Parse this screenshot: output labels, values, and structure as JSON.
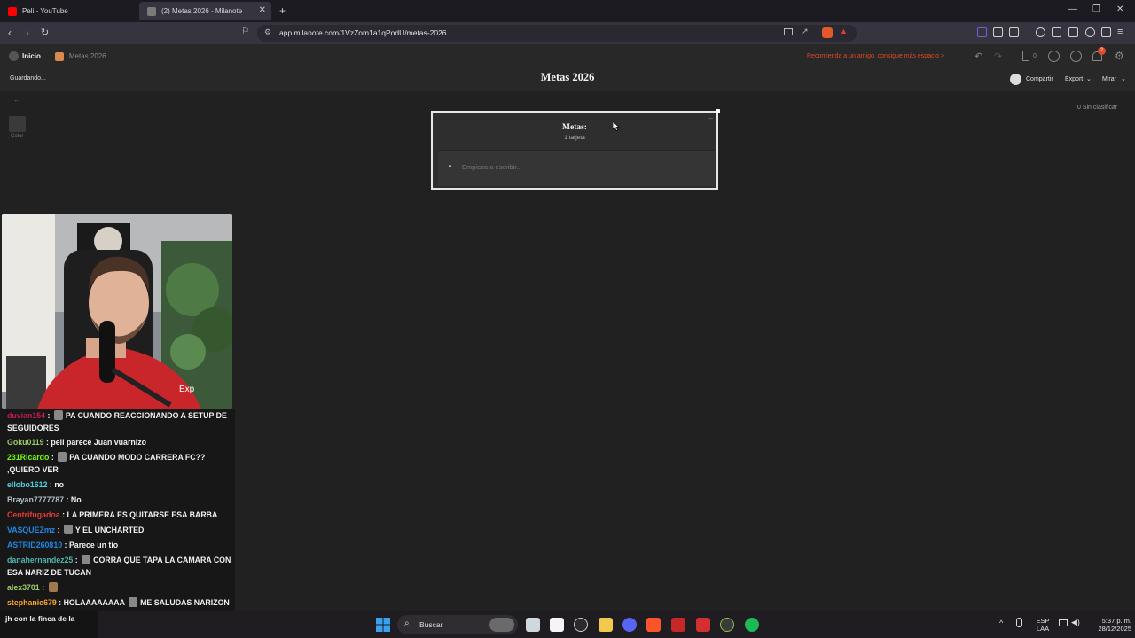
{
  "browser": {
    "tabs": [
      {
        "title": "Peli - YouTube",
        "active": false,
        "favicon_color": "#ff0000"
      },
      {
        "title": "(2) Metas 2026 - Milanote",
        "active": true,
        "favicon_color": "#7a7a7a"
      }
    ],
    "new_tab_label": "+",
    "url": "app.milanote.com/1VzZom1a1qPodU/metas-2026"
  },
  "app": {
    "breadcrumb": {
      "home": "Inicio",
      "board": "Metas 2026"
    },
    "save_status": "Guardando...",
    "board_title": "Metas 2026",
    "promo": "Recomienda a un amigo, consigue más espacio >",
    "card_counter": "0",
    "notifications_count": "2",
    "share_label": "Compartir",
    "export_label": "Export",
    "view_label": "Mirar",
    "unsorted_label": "0 Sin clasificar",
    "toolbar": {
      "color_label": "Color"
    },
    "column": {
      "title": "Metas:",
      "count": "1 tarjeta",
      "placeholder": "Empieza a escribir..."
    }
  },
  "chat": {
    "messages": [
      {
        "user": "duvian154",
        "color": "#c2185b",
        "text": "PA CUANDO REACCIONANDO A SETUP DE SEGUIDORES",
        "emote": true
      },
      {
        "user": "Goku0119",
        "color": "#9ccc65",
        "text": "peli parece Juan vuarnizo",
        "emote": false
      },
      {
        "user": "231RIcardo",
        "color": "#76ff03",
        "text": "PA CUANDO MODO CARRERA FC?? ,QUIERO VER",
        "emote": true
      },
      {
        "user": "ellobo1612",
        "color": "#4dd0e1",
        "text": "no",
        "emote": false
      },
      {
        "user": "Brayan7777787",
        "color": "#b0bec5",
        "text": "No",
        "emote": false
      },
      {
        "user": "Centrifugadoa",
        "color": "#e53935",
        "text": "LA PRIMERA ES QUITARSE ESA BARBA",
        "emote": false
      },
      {
        "user": "VASQUEZmz",
        "color": "#1e88e5",
        "text": "Y EL UNCHARTED",
        "emote": true
      },
      {
        "user": "ASTRID260810",
        "color": "#1e88e5",
        "text": "Parece un tío",
        "emote": false
      },
      {
        "user": "danahernandez25",
        "color": "#4db6ac",
        "text": "CORRA QUE TAPA LA CAMARA CON ESA NARIZ DE TUCAN",
        "emote": true
      },
      {
        "user": "alex3701",
        "color": "#9ccc65",
        "text": "",
        "emote": true
      },
      {
        "user": "stephanie679",
        "color": "#ffa726",
        "text": "HOLAAAAAAAA",
        "text2": "ME SALUDAS NARIZON",
        "emote": true
      }
    ],
    "bottom_line": "jh con la finca de la"
  },
  "taskbar": {
    "search_label": "Buscar",
    "lang_top": "ESP",
    "lang_bottom": "LAA",
    "time": "5:37 p. m.",
    "date": "28/12/2025"
  }
}
